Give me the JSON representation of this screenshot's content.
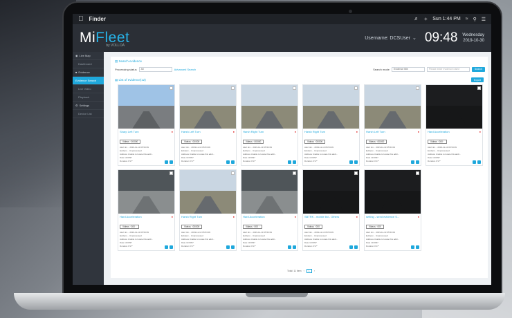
{
  "menubar": {
    "app": "Finder",
    "time": "Sun 1:44 PM"
  },
  "header": {
    "logo_main": "Mi",
    "logo_accent": "Fleet",
    "logo_sub": "by VOLLOA",
    "username_label": "Username: DCSUser",
    "clock": "09:48",
    "weekday": "Wednesday",
    "date": "2019-10-30"
  },
  "sidebar": {
    "items": [
      {
        "label": "Live Map",
        "type": "top"
      },
      {
        "label": "Dashboard",
        "type": "sub"
      },
      {
        "label": "Evidence",
        "type": "top"
      },
      {
        "label": "Evidence Search",
        "type": "active"
      },
      {
        "label": "Live Video",
        "type": "sub"
      },
      {
        "label": "Playback",
        "type": "sub"
      },
      {
        "label": "Settings",
        "type": "top"
      },
      {
        "label": "Device List",
        "type": "sub"
      }
    ]
  },
  "main": {
    "search_title": "Search evidence",
    "processing_label": "Processing status",
    "processing_value": "All",
    "advanced_link": "Advanced Search",
    "search_mode_label": "Search mode",
    "search_mode_value": "Evidence title",
    "search_placeholder": "Please enter evidence name",
    "search_button": "Search",
    "list_title": "List of evidence(12)",
    "export_button": "Export",
    "pager_total": "Total: 11 item",
    "pager_current": "1"
  },
  "cards": [
    {
      "title": "Sharp Left Turn",
      "tag": "Videos · 00/000",
      "theme": "street"
    },
    {
      "title": "Harsh Left Turn",
      "tag": "Videos · 00/000",
      "theme": "road"
    },
    {
      "title": "Harsh Right Turn",
      "tag": "Videos · 00/000",
      "theme": "road"
    },
    {
      "title": "Harsh Right Turn",
      "tag": "Videos · 00/000",
      "theme": "road"
    },
    {
      "title": "Harsh Left Turn",
      "tag": "Videos · 00/000",
      "theme": "road"
    },
    {
      "title": "Hard Acceleration",
      "tag": "Videos · 000 ·",
      "theme": "dark"
    },
    {
      "title": "Hard Acceleration",
      "tag": "Videos · 000 ·",
      "theme": "garage"
    },
    {
      "title": "Harsh Right Turn",
      "tag": "Videos · 00/000",
      "theme": "road"
    },
    {
      "title": "Hard Acceleration",
      "tag": "Videos · 000 ·",
      "theme": "garage"
    },
    {
      "title": "SBTRK - mobile list - Others",
      "tag": "Videos · 000",
      "theme": "dark"
    },
    {
      "title": "setting - send evidence S...",
      "tag": "Videos · 000",
      "theme": "dark"
    }
  ],
  "card_meta": [
    "Alert tim... 2019-11-13 05:53:09",
    "Evidenc... Unprocessed",
    "Address Unable to locate this addr...",
    "Date 11/0097",
    "Duration 0'17\""
  ],
  "colors": {
    "accent": "#1fa8dc",
    "header": "#2b2f36",
    "sidebar": "#30353d",
    "alert": "#e03131"
  }
}
